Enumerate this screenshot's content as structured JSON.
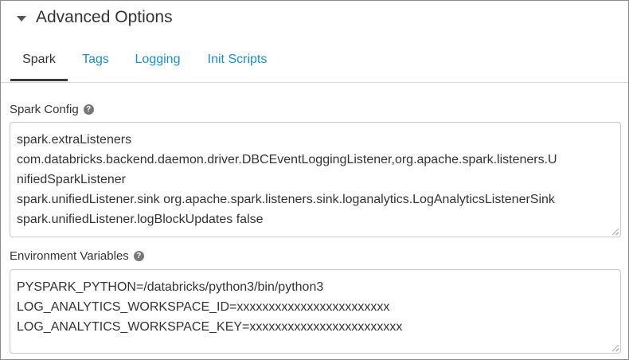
{
  "section": {
    "title": "Advanced Options"
  },
  "tabs": [
    {
      "label": "Spark",
      "active": true
    },
    {
      "label": "Tags",
      "active": false
    },
    {
      "label": "Logging",
      "active": false
    },
    {
      "label": "Init Scripts",
      "active": false
    }
  ],
  "spark_config": {
    "label": "Spark Config",
    "help_icon": "question-circle-icon",
    "lines": [
      "spark.extraListeners",
      "com.databricks.backend.daemon.driver.DBCEventLoggingListener,org.apache.spark.listeners.U",
      "nifiedSparkListener",
      "spark.unifiedListener.sink org.apache.spark.listeners.sink.loganalytics.LogAnalyticsListenerSink",
      "spark.unifiedListener.logBlockUpdates false"
    ]
  },
  "env_vars": {
    "label": "Environment Variables",
    "help_icon": "question-circle-icon",
    "lines": [
      "PYSPARK_PYTHON=/databricks/python3/bin/python3",
      "LOG_ANALYTICS_WORKSPACE_ID=xxxxxxxxxxxxxxxxxxxxxxxx",
      "LOG_ANALYTICS_WORKSPACE_KEY=xxxxxxxxxxxxxxxxxxxxxxxx"
    ]
  },
  "colors": {
    "link": "#1a8fc6",
    "text": "#333333",
    "active_tab_underline": "#3a3a3a"
  }
}
